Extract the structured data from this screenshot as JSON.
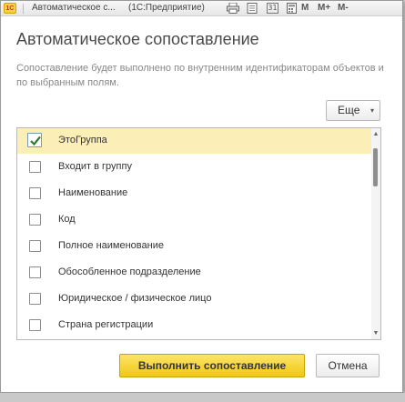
{
  "titlebar": {
    "logo": "1С",
    "window_title": "Автоматическое с...",
    "app_name": "(1С:Предприятие)",
    "buttons": [
      {
        "name": "print-icon"
      },
      {
        "name": "document-icon"
      },
      {
        "name": "calendar-icon",
        "label": "31"
      },
      {
        "name": "calculator-icon"
      },
      {
        "name": "memory-label",
        "label": "M"
      },
      {
        "name": "memory-plus",
        "label": "M+"
      },
      {
        "name": "memory-minus",
        "label": "M-"
      }
    ]
  },
  "dialog": {
    "title": "Автоматическое сопоставление",
    "description": "Сопоставление будет выполнено по внутренним идентификаторам объектов и по выбранным полям.",
    "more_button": "Еще",
    "fields": [
      {
        "label": "ЭтоГруппа",
        "checked": true
      },
      {
        "label": "Входит в группу",
        "checked": false
      },
      {
        "label": "Наименование",
        "checked": false
      },
      {
        "label": "Код",
        "checked": false
      },
      {
        "label": "Полное наименование",
        "checked": false
      },
      {
        "label": "Обособленное подразделение",
        "checked": false
      },
      {
        "label": "Юридическое / физическое лицо",
        "checked": false
      },
      {
        "label": "Страна регистрации",
        "checked": false
      }
    ],
    "run_button": "Выполнить сопоставление",
    "cancel_button": "Отмена"
  }
}
